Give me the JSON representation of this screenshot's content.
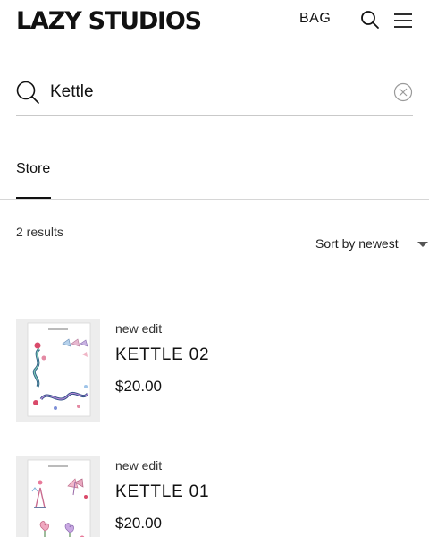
{
  "header": {
    "logo": "LAZY STUDIOS",
    "bag_label": "BAG",
    "search_icon": "search-icon",
    "menu_icon": "hamburger-menu-icon"
  },
  "search": {
    "value": "Kettle",
    "icon": "search-icon",
    "clear_icon": "clear-circle-x-icon"
  },
  "tabs": [
    {
      "label": "Store",
      "active": true
    }
  ],
  "results": {
    "count_text": "2 results",
    "sort_label": "Sort by newest"
  },
  "products": [
    {
      "tag": "new edit",
      "name": "KETTLE 02",
      "price": "$20.00"
    },
    {
      "tag": "new edit",
      "name": "KETTLE 01",
      "price": "$20.00"
    }
  ],
  "colors": {
    "text": "#111111",
    "divider": "#c9c9c9",
    "thumb_bg": "#ededed"
  }
}
